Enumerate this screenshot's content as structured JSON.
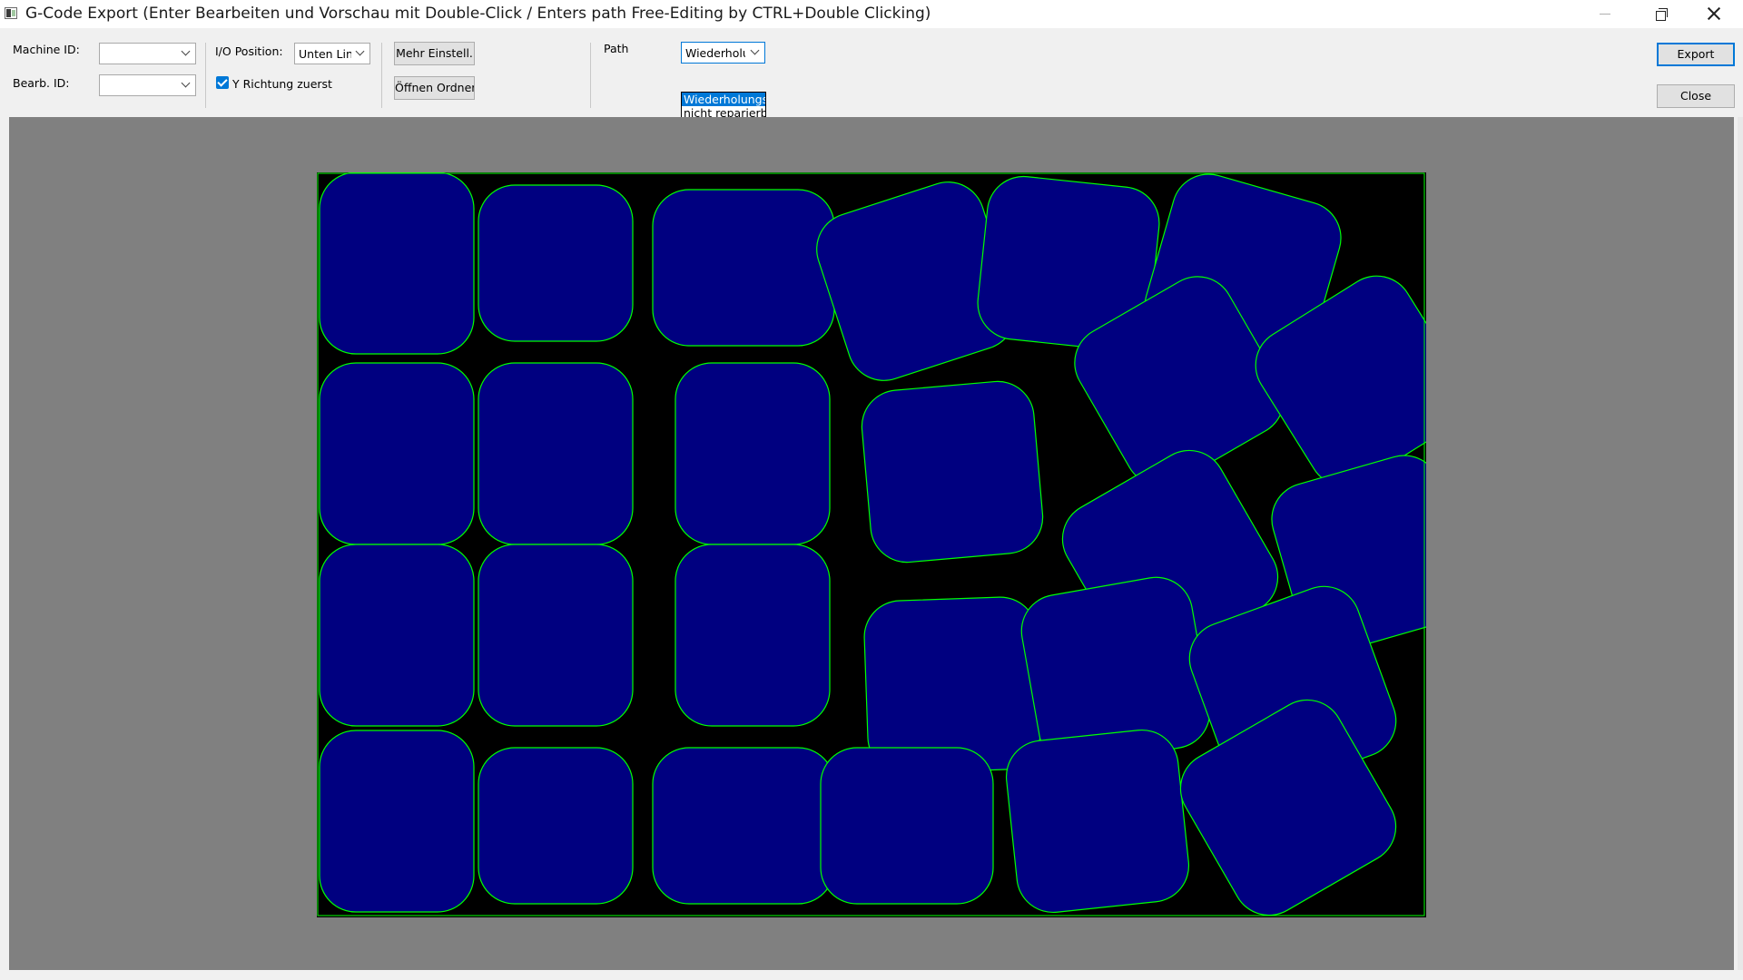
{
  "window": {
    "title": "G-Code Export (Enter Bearbeiten und Vorschau mit Double-Click / Enters path Free-Editing by CTRL+Double Clicking)"
  },
  "toolbar": {
    "machine_id_label": "Machine ID:",
    "machine_id_value": "",
    "bearb_id_label": "Bearb. ID:",
    "bearb_id_value": "",
    "io_position_label": "I/O Position:",
    "io_position_value": "Unten Link",
    "y_direction_label": "Y Richtung zuerst",
    "y_direction_checked": true,
    "more_settings_label": "Mehr Einstell.",
    "open_folder_label": "Öffnen Ordner",
    "path_label": "Path",
    "path_value": "Wiederholu",
    "path_options": [
      "Wiederholungsb",
      "nicht reparierba"
    ],
    "export_label": "Export",
    "close_label": "Close"
  },
  "preview": {
    "workpiece_color": "#000000",
    "piece_fill": "#000080",
    "path_color": "#00ff00",
    "frame_color": "#808080"
  }
}
